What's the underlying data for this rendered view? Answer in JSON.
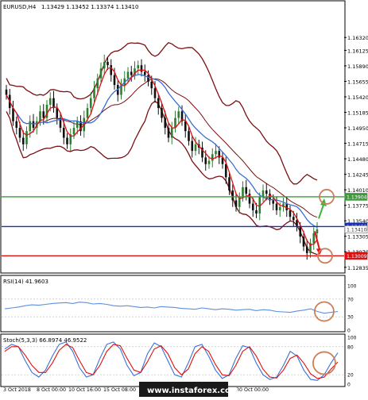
{
  "header": {
    "symbol": "EURUSD,H4",
    "ohlc": "1.13429 1.13452 1.13374 1.13410"
  },
  "watermark": "www.instaforex.com",
  "colors": {
    "candle_up": "#2e7d32",
    "candle_down": "#111111",
    "bollinger": "#7a0f12",
    "ma_fast": "#e01010",
    "ma_slow": "#3a6fd8",
    "level_resistance": "#3c9a3c",
    "level_current": "#1530c8",
    "level_support": "#e01010",
    "rsi_line": "#5b8fe0",
    "stoch_main": "#3a6fd8",
    "stoch_signal": "#e01010",
    "annotation_circle": "#c9805a"
  },
  "chart_data": [
    {
      "type": "candlestick",
      "title": "EURUSD,H4",
      "ohlc_readout": [
        1.13429,
        1.13452,
        1.13374,
        1.1341
      ],
      "ylim": [
        1.1276,
        1.1672
      ],
      "y_ticks": [
        "1.16320",
        "1.16125",
        "1.15890",
        "1.15655",
        "1.15420",
        "1.15185",
        "1.14950",
        "1.14715",
        "1.14480",
        "1.14245",
        "1.14010",
        "1.13775",
        "1.13540",
        "1.13305",
        "1.13070",
        "1.12835"
      ],
      "x_tick_labels": [
        "3 Oct 2018",
        "8 Oct 00:00",
        "10 Oct 16:00",
        "15 Oct 08:00",
        "30 Oct 00:00"
      ],
      "price_tags": [
        {
          "label": "1.13904",
          "value": 1.13904,
          "role": "resistance"
        },
        {
          "label": "1.13453",
          "value": 1.13453,
          "role": "current"
        },
        {
          "label": "1.13410",
          "value": 1.1341,
          "role": "last"
        },
        {
          "label": "1.13009",
          "value": 1.13009,
          "role": "support"
        }
      ],
      "close_series": [
        1.1545,
        1.1525,
        1.1505,
        1.1495,
        1.148,
        1.147,
        1.149,
        1.1505,
        1.1495,
        1.1505,
        1.152,
        1.151,
        1.153,
        1.154,
        1.1525,
        1.151,
        1.1495,
        1.148,
        1.147,
        1.1485,
        1.1495,
        1.1505,
        1.149,
        1.151,
        1.1525,
        1.154,
        1.1555,
        1.157,
        1.1585,
        1.1595,
        1.159,
        1.1575,
        1.156,
        1.1545,
        1.156,
        1.157,
        1.158,
        1.1575,
        1.1585,
        1.159,
        1.158,
        1.1575,
        1.1565,
        1.1555,
        1.154,
        1.1525,
        1.151,
        1.1495,
        1.148,
        1.1495,
        1.151,
        1.152,
        1.1505,
        1.149,
        1.1475,
        1.146,
        1.147,
        1.1465,
        1.145,
        1.144,
        1.1445,
        1.1455,
        1.146,
        1.145,
        1.144,
        1.142,
        1.14,
        1.1385,
        1.1375,
        1.139,
        1.1405,
        1.1395,
        1.138,
        1.137,
        1.1365,
        1.139,
        1.14,
        1.1395,
        1.1385,
        1.138,
        1.137,
        1.1375,
        1.138,
        1.137,
        1.136,
        1.1355,
        1.1345,
        1.133,
        1.1315,
        1.1305,
        1.132,
        1.1335,
        1.1341
      ],
      "annotations": [
        "up arrow to 1.13904",
        "down arrow to 1.13009"
      ]
    },
    {
      "type": "line",
      "title": "RSI(14) 41.9603",
      "ylim": [
        0,
        100
      ],
      "y_ticks": [
        "100",
        "70",
        "30",
        "0"
      ],
      "series": [
        {
          "name": "RSI(14)",
          "values": [
            48,
            50,
            52,
            55,
            57,
            56,
            58,
            60,
            61,
            62,
            60,
            63,
            62,
            59,
            60,
            58,
            55,
            54,
            55,
            53,
            51,
            52,
            50,
            53,
            52,
            51,
            49,
            48,
            47,
            50,
            48,
            46,
            48,
            47,
            45,
            46,
            47,
            44,
            46,
            45,
            42,
            41,
            40,
            43,
            45,
            48,
            42,
            38,
            40,
            41.96
          ]
        }
      ]
    },
    {
      "type": "line",
      "title": "Stoch(5,3,3) 66.8974 46.9522",
      "ylim": [
        0,
        100
      ],
      "y_ticks": [
        "100",
        "80",
        "20",
        "0"
      ],
      "series": [
        {
          "name": "main",
          "values": [
            75,
            85,
            80,
            50,
            25,
            15,
            30,
            60,
            85,
            90,
            70,
            35,
            15,
            20,
            55,
            85,
            90,
            75,
            40,
            18,
            25,
            65,
            88,
            80,
            50,
            20,
            15,
            45,
            80,
            85,
            60,
            30,
            12,
            20,
            55,
            82,
            78,
            45,
            20,
            10,
            15,
            40,
            70,
            60,
            30,
            10,
            8,
            20,
            45,
            66.9
          ]
        },
        {
          "name": "signal",
          "values": [
            70,
            80,
            80,
            62,
            40,
            25,
            25,
            45,
            72,
            85,
            78,
            50,
            25,
            20,
            40,
            70,
            85,
            82,
            55,
            30,
            25,
            48,
            75,
            82,
            65,
            35,
            20,
            32,
            65,
            80,
            70,
            42,
            20,
            18,
            40,
            70,
            80,
            60,
            32,
            15,
            13,
            30,
            55,
            62,
            45,
            22,
            12,
            15,
            32,
            46.95
          ]
        }
      ]
    }
  ]
}
